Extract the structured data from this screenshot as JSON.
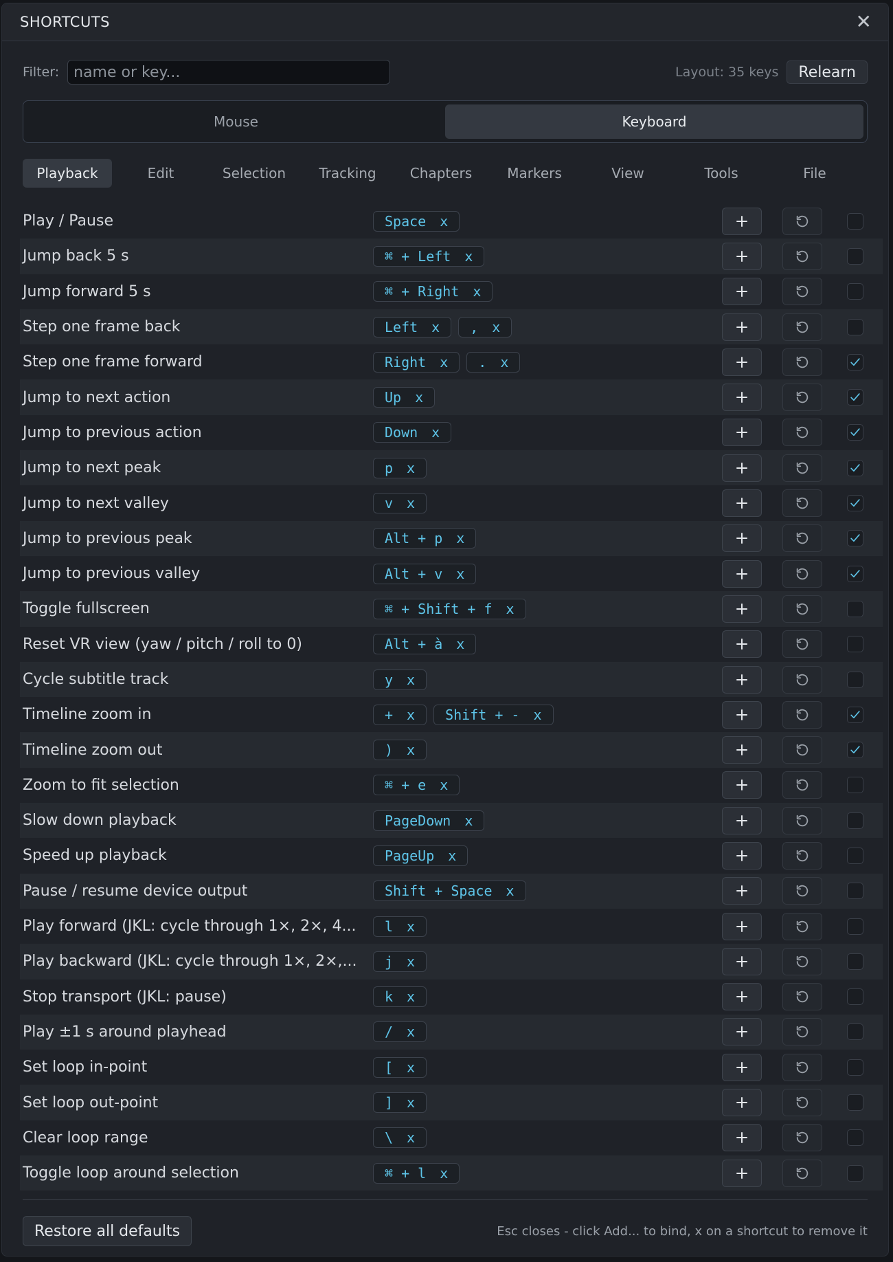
{
  "dialog": {
    "title": "SHORTCUTS",
    "filter_label": "Filter:",
    "filter_placeholder": "name or key...",
    "filter_value": "",
    "layout_info": "Layout: 35 keys",
    "relearn_label": "Relearn"
  },
  "modes": [
    {
      "label": "Mouse",
      "active": false
    },
    {
      "label": "Keyboard",
      "active": true
    }
  ],
  "tabs": [
    {
      "label": "Playback",
      "active": true
    },
    {
      "label": "Edit",
      "active": false
    },
    {
      "label": "Selection",
      "active": false
    },
    {
      "label": "Tracking",
      "active": false
    },
    {
      "label": "Chapters",
      "active": false
    },
    {
      "label": "Markers",
      "active": false
    },
    {
      "label": "View",
      "active": false
    },
    {
      "label": "Tools",
      "active": false
    },
    {
      "label": "File",
      "active": false
    }
  ],
  "shortcuts": [
    {
      "label": "Play / Pause",
      "keys": [
        "Space"
      ],
      "checked": false
    },
    {
      "label": "Jump back 5 s",
      "keys": [
        "⌘ + Left"
      ],
      "checked": false
    },
    {
      "label": "Jump forward 5 s",
      "keys": [
        "⌘ + Right"
      ],
      "checked": false
    },
    {
      "label": "Step one frame back",
      "keys": [
        "Left",
        ","
      ],
      "checked": false
    },
    {
      "label": "Step one frame forward",
      "keys": [
        "Right",
        "."
      ],
      "checked": true
    },
    {
      "label": "Jump to next action",
      "keys": [
        "Up"
      ],
      "checked": true
    },
    {
      "label": "Jump to previous action",
      "keys": [
        "Down"
      ],
      "checked": true
    },
    {
      "label": "Jump to next peak",
      "keys": [
        "p"
      ],
      "checked": true
    },
    {
      "label": "Jump to next valley",
      "keys": [
        "v"
      ],
      "checked": true
    },
    {
      "label": "Jump to previous peak",
      "keys": [
        "Alt + p"
      ],
      "checked": true
    },
    {
      "label": "Jump to previous valley",
      "keys": [
        "Alt + v"
      ],
      "checked": true
    },
    {
      "label": "Toggle fullscreen",
      "keys": [
        "⌘ + Shift + f"
      ],
      "checked": false
    },
    {
      "label": "Reset VR view (yaw / pitch / roll to 0)",
      "keys": [
        "Alt + à"
      ],
      "checked": false
    },
    {
      "label": "Cycle subtitle track",
      "keys": [
        "y"
      ],
      "checked": false
    },
    {
      "label": "Timeline zoom in",
      "keys": [
        "+",
        "Shift + -"
      ],
      "checked": true
    },
    {
      "label": "Timeline zoom out",
      "keys": [
        ")"
      ],
      "checked": true
    },
    {
      "label": "Zoom to fit selection",
      "keys": [
        "⌘ + e"
      ],
      "checked": false
    },
    {
      "label": "Slow down playback",
      "keys": [
        "PageDown"
      ],
      "checked": false
    },
    {
      "label": "Speed up playback",
      "keys": [
        "PageUp"
      ],
      "checked": false
    },
    {
      "label": "Pause / resume device output",
      "keys": [
        "Shift + Space"
      ],
      "checked": false
    },
    {
      "label": "Play forward (JKL: cycle through 1×, 2×, 4...",
      "keys": [
        "l"
      ],
      "checked": false
    },
    {
      "label": "Play backward (JKL: cycle through 1×, 2×,...",
      "keys": [
        "j"
      ],
      "checked": false
    },
    {
      "label": "Stop transport (JKL: pause)",
      "keys": [
        "k"
      ],
      "checked": false
    },
    {
      "label": "Play ±1 s around playhead",
      "keys": [
        "/"
      ],
      "checked": false
    },
    {
      "label": "Set loop in-point",
      "keys": [
        "["
      ],
      "checked": false
    },
    {
      "label": "Set loop out-point",
      "keys": [
        "]"
      ],
      "checked": false
    },
    {
      "label": "Clear loop range",
      "keys": [
        "\\"
      ],
      "checked": false
    },
    {
      "label": "Toggle loop around selection",
      "keys": [
        "⌘ + l"
      ],
      "checked": false
    }
  ],
  "chip_remove_glyph": "x",
  "footer": {
    "restore_label": "Restore all defaults",
    "hint": "Esc closes - click Add... to bind, x on a shortcut to remove it"
  },
  "icons": {
    "close": "close-icon",
    "add": "plus-icon",
    "reset": "reset-icon",
    "check": "check-icon"
  },
  "colors": {
    "accent": "#5ec4e8",
    "background": "#1f2228",
    "row_alt": "#262a30"
  }
}
